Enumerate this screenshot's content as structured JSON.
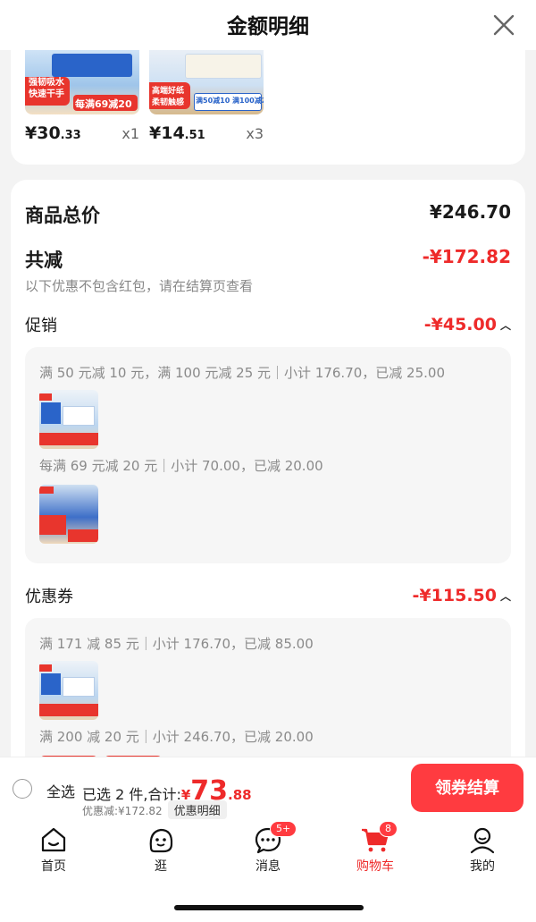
{
  "header": {
    "title": "金额明细"
  },
  "items": [
    {
      "price_int": "¥30",
      "price_dec": ".33",
      "qty": "x1",
      "thumb_texts": [
        "强韧吸水",
        "快速干手",
        "每满69减20"
      ]
    },
    {
      "price_int": "¥14",
      "price_dec": ".51",
      "qty": "x3",
      "thumb_texts": [
        "高端好纸",
        "柔韧触感",
        "满50减10 满100减25"
      ]
    }
  ],
  "summary": {
    "goods_total_label": "商品总价",
    "goods_total_value": "¥246.70",
    "total_discount_label": "共减",
    "total_discount_value": "-¥172.82",
    "note": "以下优惠不包含红包，请在结算页查看"
  },
  "promotion": {
    "label": "促销",
    "amount": "-¥45.00",
    "rules": [
      "满 50 元减 10 元，满 100 元减 25 元｜小计 176.70，已减 25.00",
      "每满 69 元减 20 元｜小计 70.00，已减 20.00"
    ]
  },
  "coupon": {
    "label": "优惠券",
    "amount": "-¥115.50",
    "rules": [
      "满 171 减 85 元｜小计 176.70，已减 85.00",
      "满 200 减 20 元｜小计 246.70，已减 20.00"
    ]
  },
  "bottom_bar": {
    "select_all": "全选",
    "selected_prefix": "已选 2 件,合计:",
    "total_symbol": "¥",
    "total_int": "73",
    "total_dec": ".88",
    "discount_line": "优惠减:¥172.82",
    "detail_chip": "优惠明细",
    "checkout": "领券结算"
  },
  "tabs": [
    {
      "label": "首页",
      "icon": "home-icon"
    },
    {
      "label": "逛",
      "icon": "face-icon"
    },
    {
      "label": "消息",
      "icon": "chat-icon",
      "badge": "5+"
    },
    {
      "label": "购物车",
      "icon": "cart-icon",
      "badge": "8",
      "active": true
    },
    {
      "label": "我的",
      "icon": "user-icon"
    }
  ],
  "colors": {
    "accent": "#ee2a2a",
    "button": "#ff3b40"
  }
}
